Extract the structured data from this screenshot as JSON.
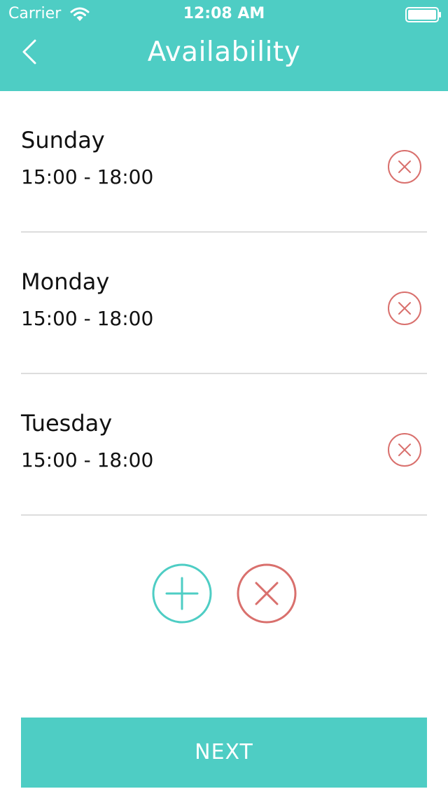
{
  "status_bar": {
    "carrier": "Carrier",
    "time": "12:08 AM",
    "wifi_icon": "wifi-icon",
    "battery_icon": "battery-icon"
  },
  "header": {
    "title": "Availability",
    "back_icon": "chevron-left-icon"
  },
  "availability": [
    {
      "day": "Sunday",
      "time": "15:00 - 18:00"
    },
    {
      "day": "Monday",
      "time": "15:00 - 18:00"
    },
    {
      "day": "Tuesday",
      "time": "15:00 - 18:00"
    }
  ],
  "actions": {
    "add_icon": "plus-circle-icon",
    "clear_icon": "close-circle-icon",
    "remove_icon": "close-circle-icon"
  },
  "footer": {
    "next_label": "NEXT"
  },
  "colors": {
    "accent": "#4ecdc4",
    "danger": "#d9706d",
    "divider": "#dddddd"
  }
}
